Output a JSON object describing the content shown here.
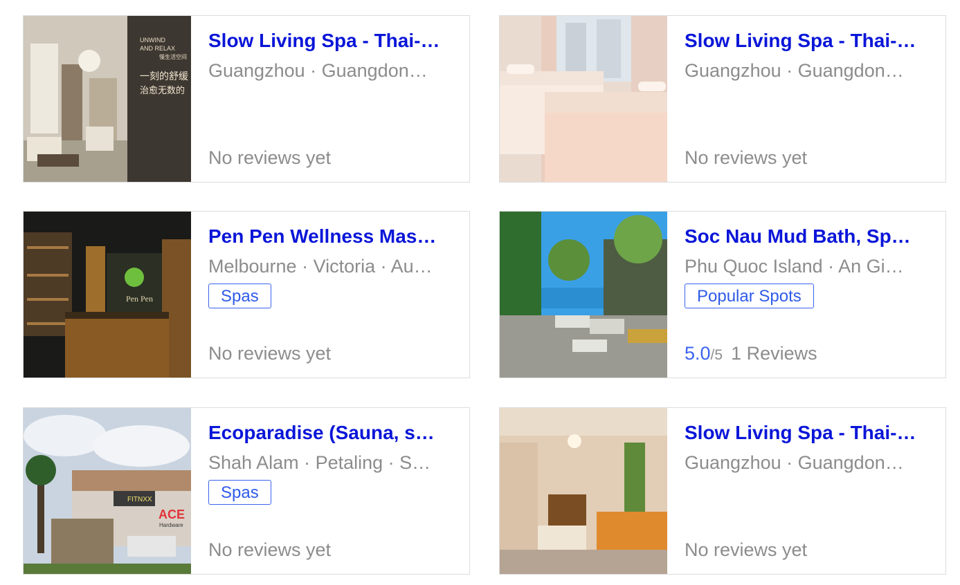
{
  "cards": [
    {
      "title": "Slow Living Spa - Thai-…",
      "location": "Guangzhou · Guangdon…",
      "tag": "",
      "reviews": "No reviews yet",
      "img_text_1": "UNWIND",
      "img_text_2": "AND RELAX",
      "img_text_3": "慢生活空间",
      "img_text_4": "一刻的舒缓",
      "img_text_5": "治愈无数的"
    },
    {
      "title": "Slow Living Spa - Thai-…",
      "location": "Guangzhou · Guangdon…",
      "tag": "",
      "reviews": "No reviews yet"
    },
    {
      "title": "Pen Pen Wellness Mas…",
      "location": "Melbourne · Victoria · Au…",
      "tag": "Spas",
      "reviews": "No reviews yet",
      "img_text_1": "Pen Pen"
    },
    {
      "title": "Soc Nau Mud Bath, Sp…",
      "location": "Phu Quoc Island · An Gi…",
      "tag": "Popular Spots",
      "score": "5.0",
      "score_outof": "/5",
      "review_count": "1 Reviews"
    },
    {
      "title": "Ecoparadise (Sauna, s…",
      "location": "Shah Alam · Petaling · S…",
      "tag": "Spas",
      "reviews": "No reviews yet",
      "img_text_1": "FITNXX",
      "img_text_2": "ACE",
      "img_text_3": "Hardware"
    },
    {
      "title": "Slow Living Spa - Thai-…",
      "location": "Guangzhou · Guangdon…",
      "tag": "",
      "reviews": "No reviews yet"
    }
  ]
}
